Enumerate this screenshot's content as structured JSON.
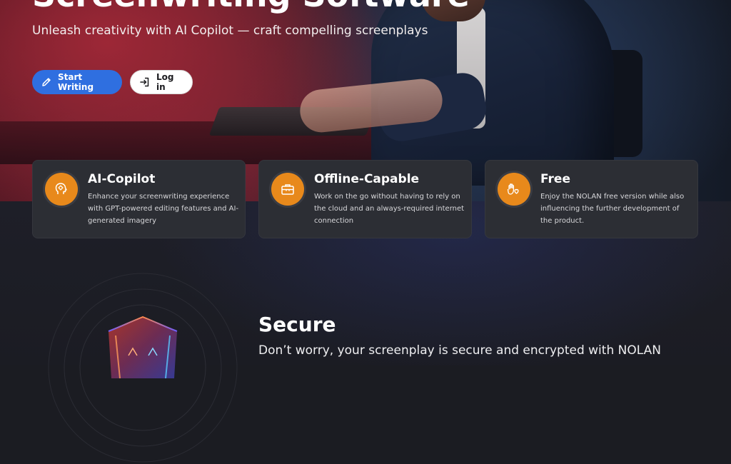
{
  "hero": {
    "title": "Screenwriting Software",
    "subtitle": "Unleash creativity with AI Copilot — craft compelling screenplays",
    "primary_button": {
      "label": "Start Writing",
      "icon": "pencil-icon"
    },
    "secondary_button": {
      "label": "Log in",
      "icon": "login-icon"
    }
  },
  "features": [
    {
      "title": "AI-Copilot",
      "description": "Enhance your screenwriting experience with GPT-powered editing features and AI-generated imagery",
      "icon": "brain-head-icon"
    },
    {
      "title": "Offline-Capable",
      "description": "Work on the go without having to rely on the cloud and an always-required internet connection",
      "icon": "briefcase-icon"
    },
    {
      "title": "Free",
      "description": "Enjoy the NOLAN free version while also influencing the further development of the product.",
      "icon": "hand-heart-icon"
    }
  ],
  "secure": {
    "title": "Secure",
    "text": "Don’t worry, your screenplay is secure and encrypted with NOLAN",
    "icon": "shield-icon"
  },
  "colors": {
    "accent": "#2f6fe0",
    "feature_badge": "#e8891b",
    "card_background": "#2c2e34",
    "page_background": "#1b1c22"
  }
}
